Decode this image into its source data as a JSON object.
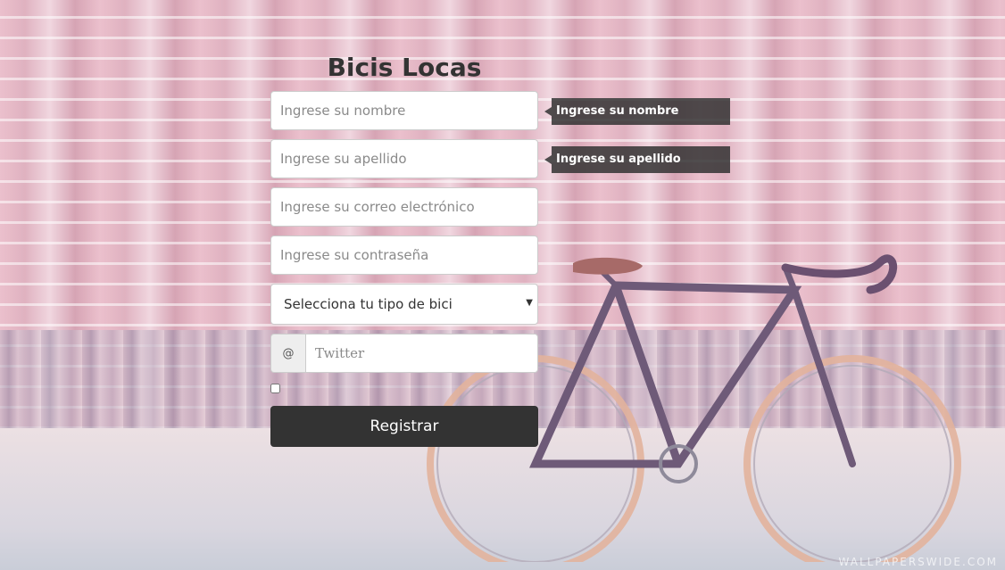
{
  "form": {
    "title": "Bicis Locas",
    "first_name_placeholder": "Ingrese su nombre",
    "last_name_placeholder": "Ingrese su apellido",
    "email_placeholder": "Ingrese su correo electrónico",
    "password_placeholder": "Ingrese su contraseña",
    "bike_type_selected": "Selecciona tu tipo de bici",
    "twitter_addon": "@",
    "twitter_placeholder": "Twitter",
    "submit_label": "Registrar"
  },
  "tooltips": {
    "first_name": "Ingrese su nombre",
    "last_name": "Ingrese su apellido"
  },
  "icons": {
    "select_caret": "chevron-down-icon"
  },
  "colors": {
    "button_bg": "#333333",
    "tooltip_bg": "#333333",
    "title_text": "#333333"
  }
}
